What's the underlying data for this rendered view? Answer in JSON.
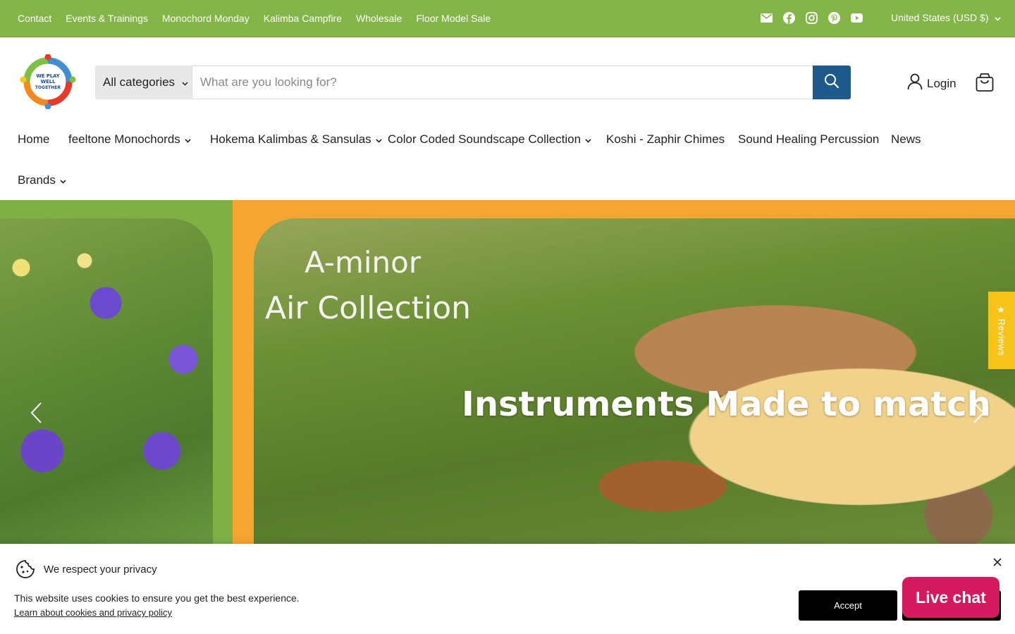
{
  "topbar": {
    "links": [
      "Contact",
      "Events & Trainings",
      "Monochord Monday",
      "Kalimba Campfire",
      "Wholesale",
      "Floor Model Sale"
    ],
    "social_icons": [
      "mail-icon",
      "facebook-icon",
      "instagram-icon",
      "pinterest-icon",
      "youtube-icon"
    ],
    "currency": "United States (USD $)",
    "background": "#83b548"
  },
  "header": {
    "logo_text": [
      "WE PLAY",
      "WELL",
      "TOGETHER"
    ],
    "category_select": "All categories",
    "search_placeholder": "What are you looking for?",
    "login_label": "Login",
    "search_button_color": "#1f5a8c"
  },
  "nav": {
    "items": [
      {
        "label": "Home",
        "dropdown": false
      },
      {
        "label": "feeltone Monochords",
        "dropdown": true
      },
      {
        "label": "Hokema Kalimbas & Sansulas",
        "dropdown": true
      },
      {
        "label": "Color Coded Soundscape Collection",
        "dropdown": true
      },
      {
        "label": "Koshi - Zaphir Chimes",
        "dropdown": false
      },
      {
        "label": "Sound Healing Percussion",
        "dropdown": false
      },
      {
        "label": "News",
        "dropdown": false
      },
      {
        "label": "Brands",
        "dropdown": true
      }
    ]
  },
  "hero": {
    "line1": "A-minor",
    "line2": "Air Collection",
    "line3": "Instruments Made to match",
    "reviews_tab": "★ Reviews"
  },
  "cookie": {
    "title": "We respect your privacy",
    "message": "This website uses cookies to ensure you get the best experience.",
    "learn_link": "Learn about cookies and privacy policy",
    "accept_label": "Accept"
  },
  "livechat": {
    "label": "Live chat",
    "color": "#d5195e"
  }
}
